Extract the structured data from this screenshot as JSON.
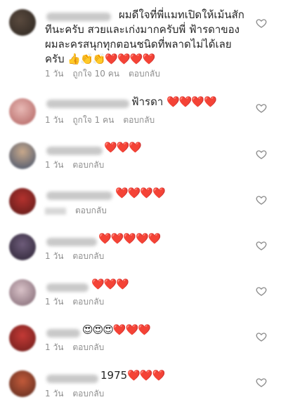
{
  "comments": [
    {
      "text": "ผมดีใจที่พี่แมทเปิดให้เม้นสักทีนะครับ สวยและเก่งมากครับพี่ ฟ้ารดาของผมละครสนุกทุกตอนชนิดที่พลาดไม่ได้เลยครับ",
      "emoji": "👍👏👏❤️❤️❤️❤️",
      "time": "1 วัน",
      "likes": "ถูกใจ 10 คน",
      "reply": "ตอบกลับ"
    },
    {
      "text": "ฟ้ารดา",
      "emoji": "❤️❤️❤️❤️",
      "time": "1 วัน",
      "likes": "ถูกใจ 1 คน",
      "reply": "ตอบกลับ"
    },
    {
      "text": "",
      "emoji": "❤️❤️❤️",
      "time": "1 วัน",
      "likes": "",
      "reply": "ตอบกลับ"
    },
    {
      "text": "",
      "emoji": "❤️❤️❤️❤️",
      "time": "",
      "likes": "",
      "reply": "ตอบกลับ"
    },
    {
      "text": "",
      "emoji": "❤️❤️❤️❤️❤️",
      "time": "1 วัน",
      "likes": "",
      "reply": "ตอบกลับ"
    },
    {
      "text": "",
      "emoji": "❤️❤️❤️",
      "time": "1 วัน",
      "likes": "",
      "reply": "ตอบกลับ"
    },
    {
      "text": "",
      "emoji": "😍😍😍❤️❤️❤️",
      "time": "1 วัน",
      "likes": "",
      "reply": "ตอบกลับ"
    },
    {
      "text": "1975",
      "emoji": "❤️❤️❤️",
      "time": "1 วัน",
      "likes": "",
      "reply": "ตอบกลับ"
    }
  ],
  "icons": {
    "like": "heart-outline-icon"
  },
  "colors": {
    "meta": "#8e8e8e",
    "text": "#262626",
    "heart": "#ed2b3a"
  }
}
